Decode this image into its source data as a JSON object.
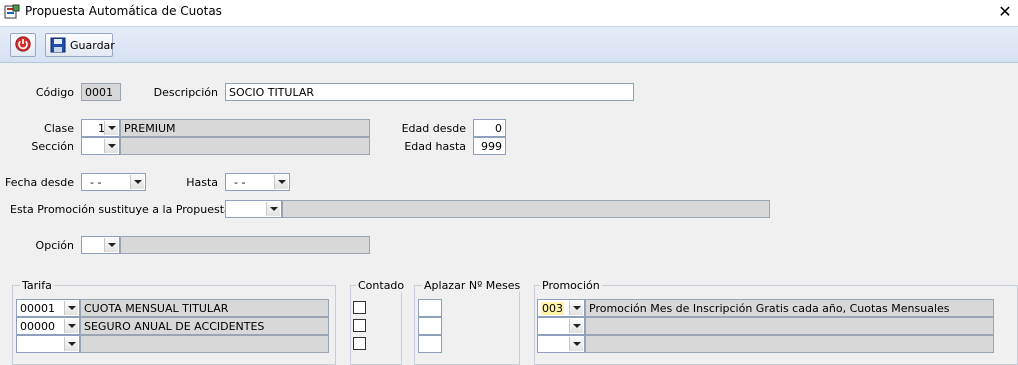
{
  "window": {
    "title": "Propuesta Automática de Cuotas",
    "close_glyph": "✕"
  },
  "toolbar": {
    "save_label": "Guardar"
  },
  "form": {
    "codigo_label": "Código",
    "codigo_value": "0001",
    "descripcion_label": "Descripción",
    "descripcion_value": "SOCIO TITULAR",
    "clase_label": "Clase",
    "clase_code": "1",
    "clase_name": "PREMIUM",
    "seccion_label": "Sección",
    "seccion_code": "",
    "seccion_name": "",
    "edad_desde_label": "Edad desde",
    "edad_desde_value": "0",
    "edad_hasta_label": "Edad hasta",
    "edad_hasta_value": "999",
    "fecha_desde_label": "Fecha desde",
    "fecha_desde_value": "- -",
    "hasta_label": "Hasta",
    "hasta_value": "- -",
    "sustituye_label": "Esta Promoción sustituye a la Propuesta",
    "sustituye_code": "",
    "sustituye_name": "",
    "opcion_label": "Opción",
    "opcion_code": "",
    "opcion_name": ""
  },
  "groups": {
    "tarifa": "Tarifa",
    "contado": "Contado",
    "aplazar": "Aplazar Nº Meses",
    "promocion": "Promoción"
  },
  "rows": [
    {
      "tarifa_code": "00001",
      "tarifa_name": "CUOTA MENSUAL TITULAR",
      "contado": false,
      "aplazar": "",
      "promo_code": "003",
      "promo_name": "Promoción Mes de Inscripción Gratis cada año, Cuotas Mensuales"
    },
    {
      "tarifa_code": "00000",
      "tarifa_name": "SEGURO ANUAL DE ACCIDENTES",
      "contado": false,
      "aplazar": "",
      "promo_code": "",
      "promo_name": ""
    },
    {
      "tarifa_code": "",
      "tarifa_name": "",
      "contado": false,
      "aplazar": "",
      "promo_code": "",
      "promo_name": ""
    }
  ],
  "colors": {
    "toolbar": "#d6e1f2",
    "readonly": "#d8d8d8",
    "highlight": "#fff4a8",
    "power": "#d32f2f",
    "disk": "#1f4fa8"
  }
}
